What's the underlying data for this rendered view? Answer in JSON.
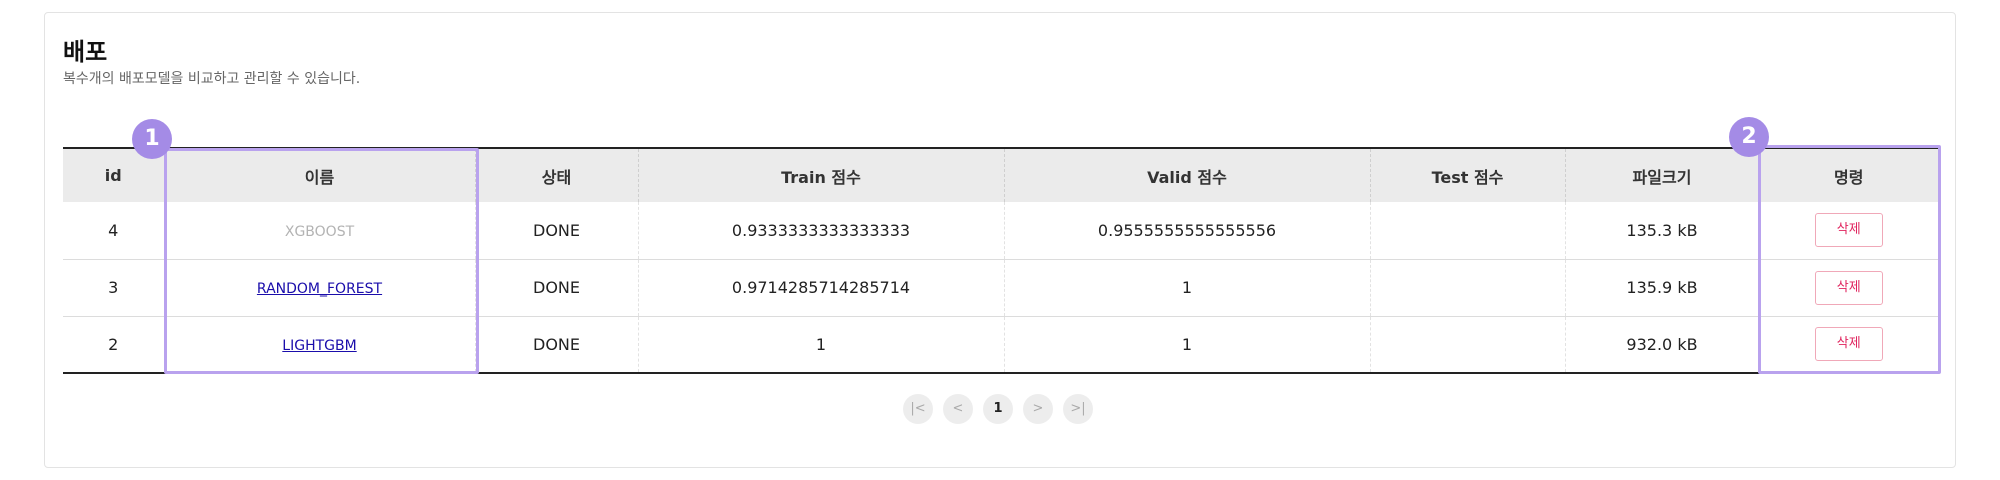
{
  "page": {
    "title": "배포",
    "subtitle": "복수개의 배포모델을 비교하고 관리할 수 있습니다."
  },
  "table": {
    "headers": [
      "id",
      "이름",
      "상태",
      "Train 점수",
      "Valid 점수",
      "Test 점수",
      "파일크기",
      "명령"
    ],
    "rows": [
      {
        "id": "4",
        "name": "XGBOOST",
        "status": "DONE",
        "train": "0.9333333333333333",
        "valid": "0.9555555555555556",
        "test": "",
        "size": "135.3 kB",
        "action": "삭제"
      },
      {
        "id": "3",
        "name": "RANDOM_FOREST",
        "status": "DONE",
        "train": "0.9714285714285714",
        "valid": "1",
        "test": "",
        "size": "135.9 kB",
        "action": "삭제"
      },
      {
        "id": "2",
        "name": "LIGHTGBM",
        "status": "DONE",
        "train": "1",
        "valid": "1",
        "test": "",
        "size": "932.0 kB",
        "action": "삭제"
      }
    ]
  },
  "annotations": {
    "badge1": "1",
    "badge2": "2",
    "highlight_color": "#b9a2ee",
    "badge_color": "#a48be6"
  },
  "pagination": {
    "first": "|<",
    "prev": "<",
    "current": "1",
    "next": ">",
    "last": ">|"
  },
  "colors": {
    "link": "#1a0dab",
    "delete": "#e0245e",
    "header_bg": "#ebebeb"
  }
}
